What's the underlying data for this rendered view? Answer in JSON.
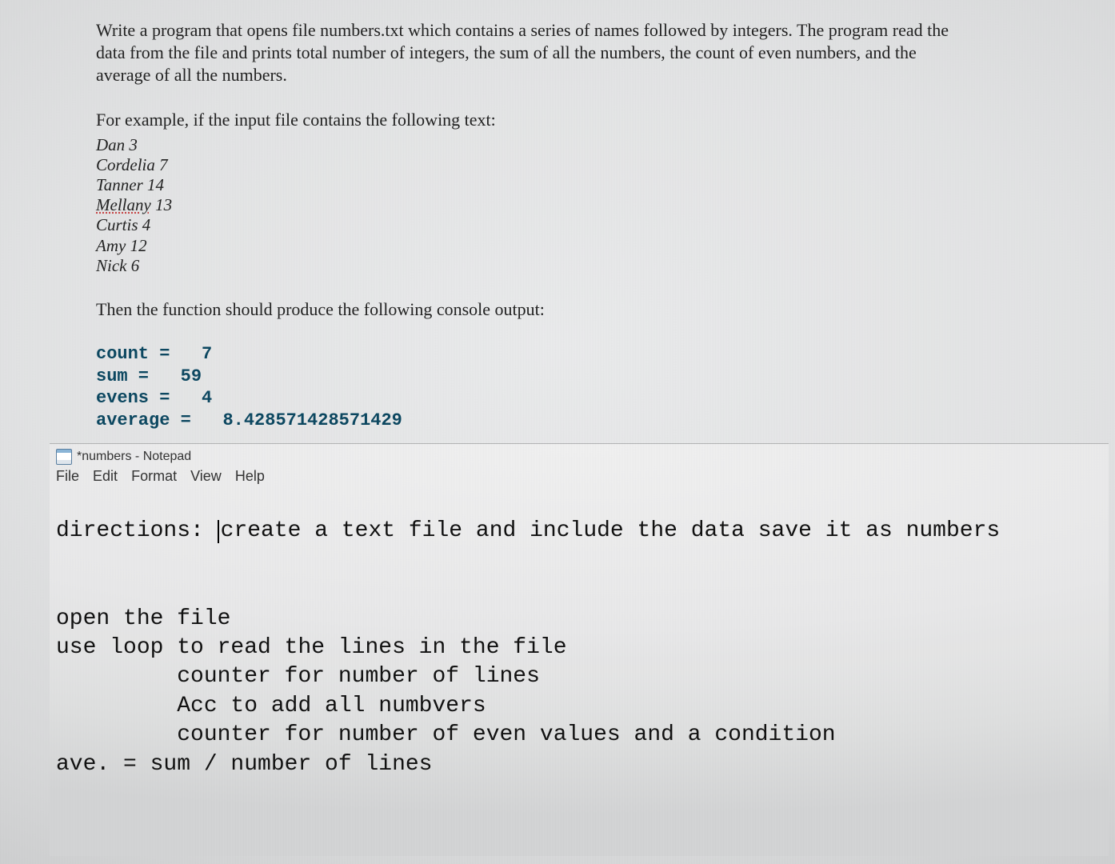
{
  "prompt": {
    "para1": "Write a program that opens file numbers.txt which contains a series of names followed by integers. The program read the data from the file and prints total number of integers, the sum of all the numbers, the count of even numbers, and the average of all the numbers.",
    "para2": "For example, if the input file contains the following text:",
    "inputs": [
      {
        "name": "Dan",
        "num": "3"
      },
      {
        "name": "Cordelia",
        "num": "7"
      },
      {
        "name": "Tanner",
        "num": "14"
      },
      {
        "name": "Mellany",
        "num": "13",
        "flag": true
      },
      {
        "name": "Curtis",
        "num": "4"
      },
      {
        "name": "Amy",
        "num": "12"
      },
      {
        "name": "Nick",
        "num": "6"
      }
    ],
    "para3": "Then the function should produce the following console output:",
    "console": {
      "count": {
        "label": "count",
        "eq": " =",
        "pad": "   ",
        "val": "7"
      },
      "sum": {
        "label": "sum",
        "eq": " =",
        "pad": "   ",
        "val": "59"
      },
      "evens": {
        "label": "evens",
        "eq": " =",
        "pad": "   ",
        "val": "4"
      },
      "average": {
        "label": "average",
        "eq": " =",
        "pad": "   ",
        "val": "8.428571428571429"
      }
    }
  },
  "notepad": {
    "title": "*numbers - Notepad",
    "menu": [
      "File",
      "Edit",
      "Format",
      "View",
      "Help"
    ],
    "lines": {
      "l1a": "directions: ",
      "l1b": "create a text file and include the data save it as numbers",
      "blank1": "",
      "blank2": "",
      "l2": "open the file",
      "l3": "use loop to read the lines in the file",
      "l4": "         counter for number of lines",
      "l5": "         Acc to add all numbvers",
      "l6": "         counter for number of even values and a condition",
      "l7": "ave. = sum / number of lines"
    }
  }
}
